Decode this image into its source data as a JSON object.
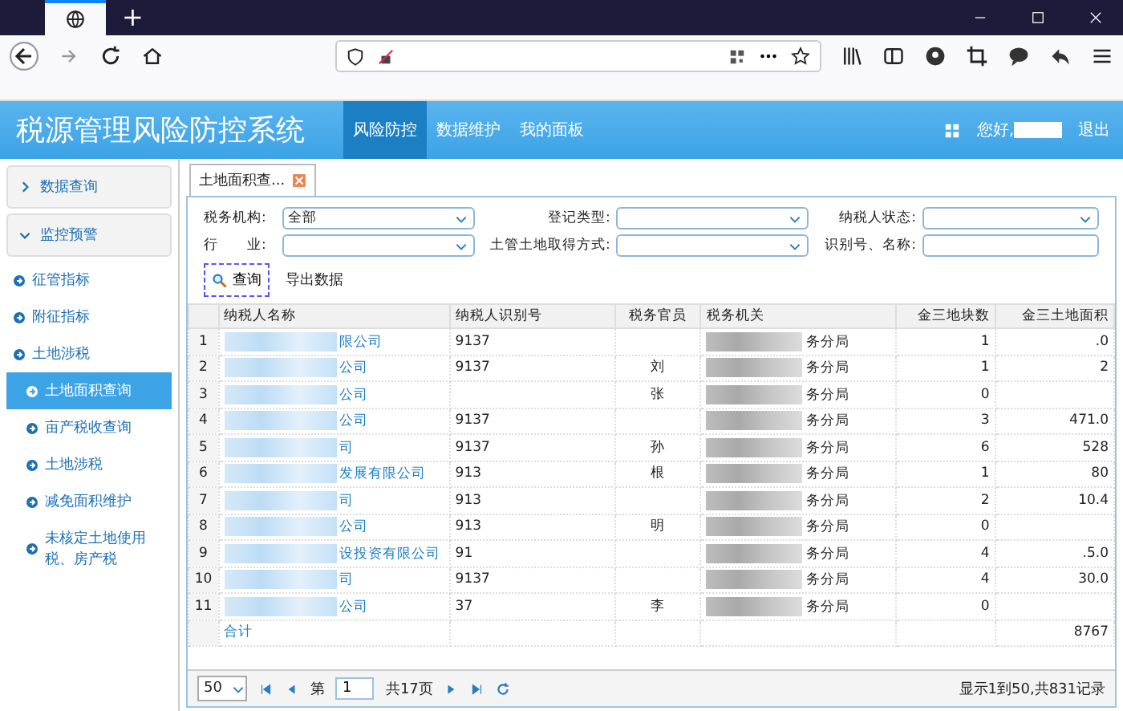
{
  "browser": {
    "new_tab": "+"
  },
  "header": {
    "title": "税源管理风险防控系统",
    "nav": [
      {
        "label": "风险防控",
        "selected": true
      },
      {
        "label": "数据维护",
        "selected": false
      },
      {
        "label": "我的面板",
        "selected": false
      }
    ],
    "greeting": "您好,",
    "logout": "退出"
  },
  "sidebar": {
    "groups": [
      {
        "label": "数据查询",
        "expanded": false
      },
      {
        "label": "监控预警",
        "expanded": true,
        "items": [
          {
            "label": "征管指标",
            "selected": false
          },
          {
            "label": "附征指标",
            "selected": false
          },
          {
            "label": "土地涉税",
            "selected": false,
            "children": [
              {
                "label": "土地面积查询",
                "selected": true
              },
              {
                "label": "亩产税收查询",
                "selected": false
              },
              {
                "label": "土地涉税",
                "selected": false
              },
              {
                "label": "减免面积维护",
                "selected": false
              },
              {
                "label": "未核定土地使用税、房产税",
                "selected": false
              }
            ]
          }
        ]
      }
    ]
  },
  "tab": {
    "label": "土地面积查..."
  },
  "filters": [
    {
      "label": "税务机构:",
      "kind": "select",
      "value": "全部"
    },
    {
      "label": "登记类型:",
      "kind": "select"
    },
    {
      "label": "纳税人状态:",
      "kind": "select"
    },
    {
      "label": "行　　业:",
      "kind": "select"
    },
    {
      "label": "土管土地取得方式:",
      "kind": "select"
    },
    {
      "label": "识别号、名称:",
      "kind": "text"
    }
  ],
  "actions": {
    "query": "查询",
    "export": "导出数据"
  },
  "table": {
    "columns": [
      "",
      "纳税人名称",
      "纳税人识别号",
      "税务官员",
      "税务机关",
      "金三地块数",
      "金三土地面积"
    ],
    "rows": [
      [
        "1",
        "限公司",
        "9137",
        "",
        "务分局",
        "1",
        ".0"
      ],
      [
        "2",
        "公司",
        "9137",
        "刘",
        "务分局",
        "1",
        "2"
      ],
      [
        "3",
        "公司",
        "",
        "张",
        "务分局",
        "0",
        ""
      ],
      [
        "4",
        "公司",
        "9137",
        "",
        "务分局",
        "3",
        "471.0"
      ],
      [
        "5",
        "司",
        "9137",
        "孙",
        "务分局",
        "6",
        "528"
      ],
      [
        "6",
        "发展有限公司",
        "913",
        "根",
        "务分局",
        "1",
        "80"
      ],
      [
        "7",
        "司",
        "913",
        "",
        "务分局",
        "2",
        "10.4"
      ],
      [
        "8",
        "公司",
        "913",
        "明",
        "务分局",
        "0",
        ""
      ],
      [
        "9",
        "设投资有限公司",
        "91",
        "",
        "务分局",
        "4",
        ".5.0"
      ],
      [
        "10",
        "司",
        "9137",
        "",
        "务分局",
        "4",
        "30.0"
      ],
      [
        "11",
        "公司",
        "37",
        "李",
        "务分局",
        "0",
        ""
      ]
    ],
    "total": {
      "label": "合计",
      "area": "8767"
    }
  },
  "pager": {
    "page_size": "50",
    "page_prefix": "第",
    "page": "1",
    "page_suffix": "共17页",
    "summary": "显示1到50,共831记录"
  }
}
